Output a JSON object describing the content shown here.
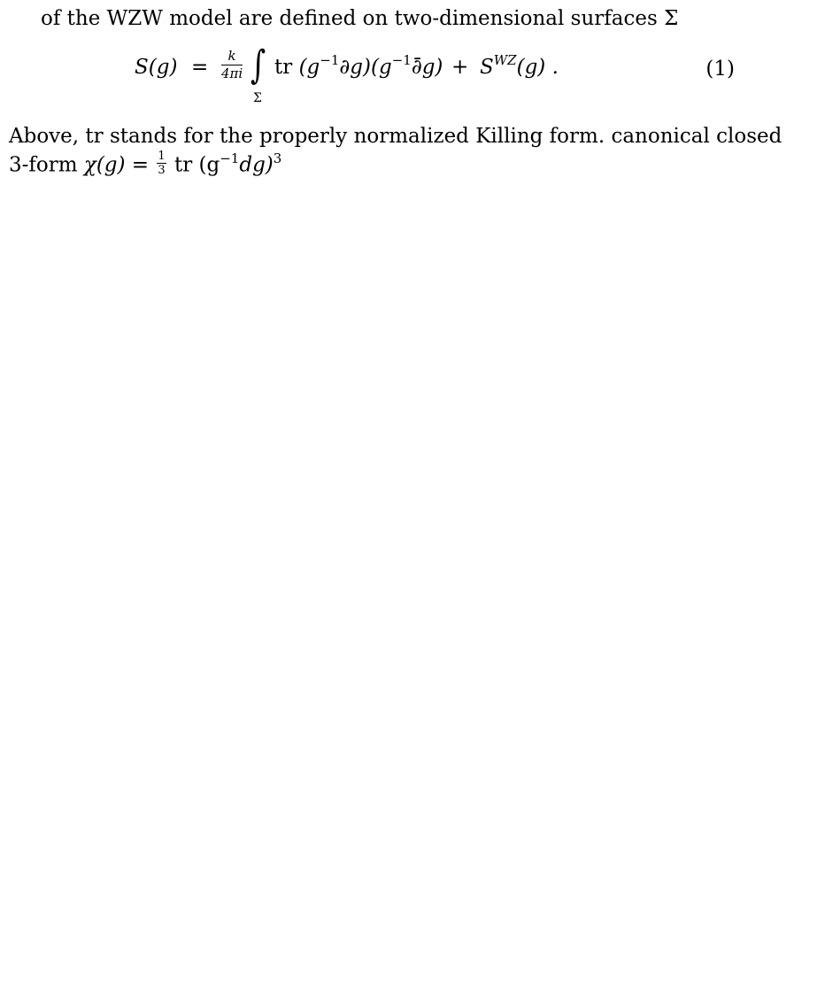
{
  "paragraph_intro": {
    "text_prefix": "of the WZW model are defined on two-dimensional surfaces ",
    "sigma": "Σ"
  },
  "equation": {
    "lhs": "S(g)",
    "equals": "=",
    "frac_num": "k",
    "frac_den": "4πi",
    "integral": "∫",
    "integral_sub": "Σ",
    "tr": "tr",
    "body_1": "(g",
    "sup_1": "−1",
    "body_2": "∂g)(g",
    "sup_2": "−1",
    "body_3": "∂̄g)",
    "plus": "+",
    "swz": "S",
    "swz_sup": "WZ",
    "swz_arg": "(g) .",
    "number": "(1)"
  },
  "paragraph_after": {
    "line1": "Above,  tr  stands for the properly normalized Killing form.  canonical closed",
    "line2_prefix": "3-form  ",
    "chi": "χ(g) = ",
    "frac_n": "1",
    "frac_d": "3",
    "tr_part": " tr (g",
    "sup_a": "−1",
    "mid": "dg)",
    "sup_b": "3"
  }
}
